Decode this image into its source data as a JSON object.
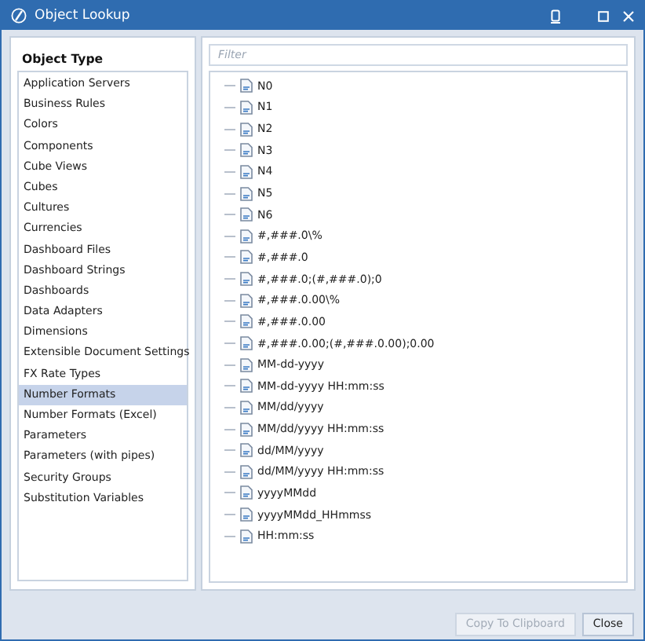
{
  "window": {
    "title": "Object Lookup"
  },
  "object_type": {
    "heading": "Object Type",
    "items": [
      {
        "label": "Application Servers",
        "selected": false
      },
      {
        "label": "Business Rules",
        "selected": false
      },
      {
        "label": "Colors",
        "selected": false
      },
      {
        "label": "Components",
        "selected": false
      },
      {
        "label": "Cube Views",
        "selected": false
      },
      {
        "label": "Cubes",
        "selected": false
      },
      {
        "label": "Cultures",
        "selected": false
      },
      {
        "label": "Currencies",
        "selected": false
      },
      {
        "label": "Dashboard Files",
        "selected": false
      },
      {
        "label": "Dashboard Strings",
        "selected": false
      },
      {
        "label": "Dashboards",
        "selected": false
      },
      {
        "label": "Data Adapters",
        "selected": false
      },
      {
        "label": "Dimensions",
        "selected": false
      },
      {
        "label": "Extensible Document Settings",
        "selected": false
      },
      {
        "label": "FX Rate Types",
        "selected": false
      },
      {
        "label": "Number Formats",
        "selected": true
      },
      {
        "label": "Number Formats (Excel)",
        "selected": false
      },
      {
        "label": "Parameters",
        "selected": false
      },
      {
        "label": "Parameters (with pipes)",
        "selected": false
      },
      {
        "label": "Security Groups",
        "selected": false
      },
      {
        "label": "Substitution Variables",
        "selected": false
      }
    ]
  },
  "filter": {
    "placeholder": "Filter"
  },
  "tree": [
    {
      "label": "N0"
    },
    {
      "label": "N1"
    },
    {
      "label": "N2"
    },
    {
      "label": "N3"
    },
    {
      "label": "N4"
    },
    {
      "label": "N5"
    },
    {
      "label": "N6"
    },
    {
      "label": "#,###.0\\%"
    },
    {
      "label": "#,###.0"
    },
    {
      "label": "#,###.0;(#,###.0);0"
    },
    {
      "label": "#,###.0.00\\%"
    },
    {
      "label": "#,###.0.00"
    },
    {
      "label": "#,###.0.00;(#,###.0.00);0.00"
    },
    {
      "label": "MM-dd-yyyy"
    },
    {
      "label": "MM-dd-yyyy HH:mm:ss"
    },
    {
      "label": "MM/dd/yyyy"
    },
    {
      "label": "MM/dd/yyyy HH:mm:ss"
    },
    {
      "label": "dd/MM/yyyy"
    },
    {
      "label": "dd/MM/yyyy HH:mm:ss"
    },
    {
      "label": "yyyyMMdd"
    },
    {
      "label": "yyyyMMdd_HHmmss"
    },
    {
      "label": "HH:mm:ss"
    }
  ],
  "buttons": [
    {
      "label": "Copy To Clipboard",
      "disabled": true
    },
    {
      "label": "Close",
      "disabled": false
    }
  ]
}
